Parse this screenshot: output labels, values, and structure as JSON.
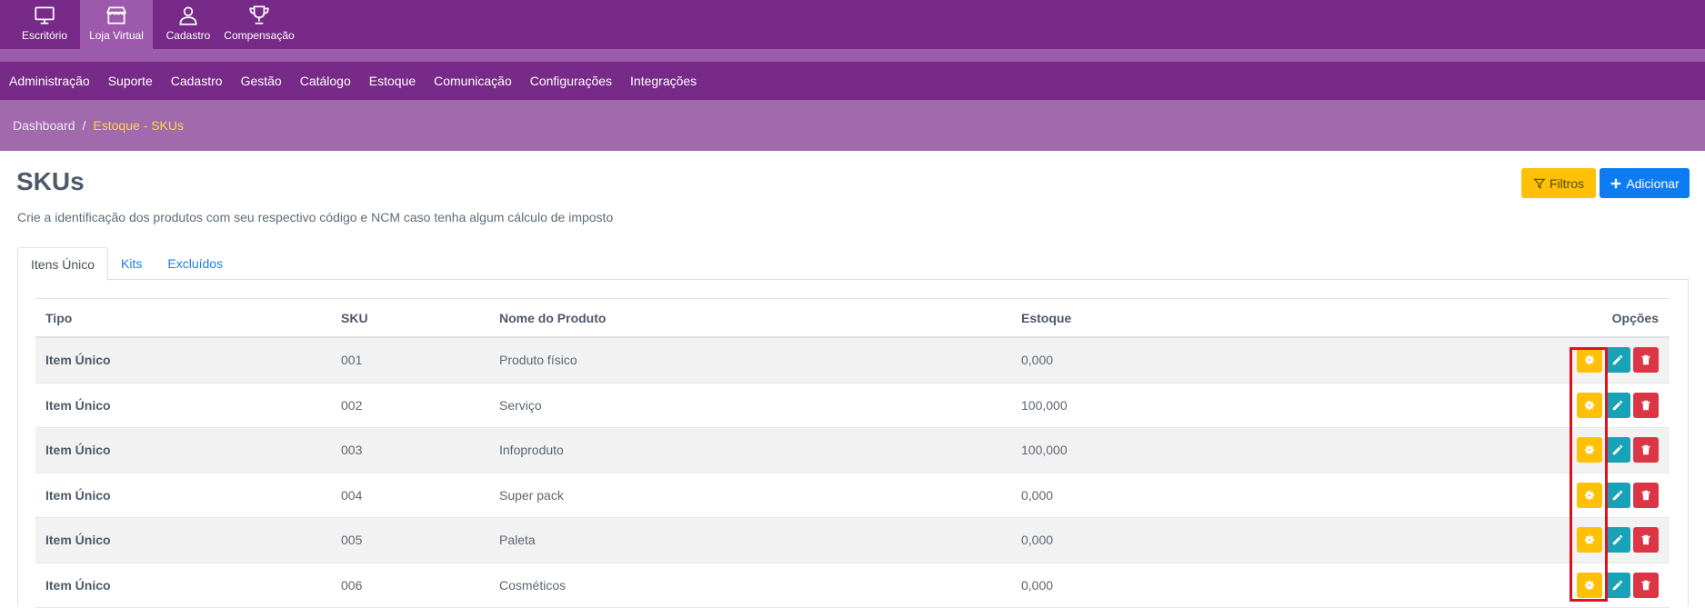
{
  "topbar": {
    "apps": [
      {
        "label": "Escritório",
        "icon": "monitor-icon"
      },
      {
        "label": "Loja Virtual",
        "icon": "store-icon",
        "active": true
      },
      {
        "label": "Cadastro",
        "icon": "user-icon"
      },
      {
        "label": "Compensação",
        "icon": "trophy-icon"
      }
    ]
  },
  "mainnav": {
    "items": [
      "Administração",
      "Suporte",
      "Cadastro",
      "Gestão",
      "Catálogo",
      "Estoque",
      "Comunicação",
      "Configurações",
      "Integrações"
    ]
  },
  "breadcrumb": {
    "home": "Dashboard",
    "separator": "/",
    "current": "Estoque - SKUs"
  },
  "page": {
    "title": "SKUs",
    "description": "Crie a identificação dos produtos com seu respectivo código e NCM caso tenha algum cálculo de imposto",
    "filter_label": "Filtros",
    "add_label": "Adicionar"
  },
  "tabs": [
    "Itens Único",
    "Kits",
    "Excluídos"
  ],
  "table": {
    "headers": {
      "tipo": "Tipo",
      "sku": "SKU",
      "nome": "Nome do Produto",
      "estoque": "Estoque",
      "opcoes": "Opções"
    },
    "rows": [
      {
        "tipo": "Item Único",
        "sku": "001",
        "nome": "Produto físico",
        "estoque": "0,000"
      },
      {
        "tipo": "Item Único",
        "sku": "002",
        "nome": "Serviço",
        "estoque": "100,000"
      },
      {
        "tipo": "Item Único",
        "sku": "003",
        "nome": "Infoproduto",
        "estoque": "100,000"
      },
      {
        "tipo": "Item Único",
        "sku": "004",
        "nome": "Super pack",
        "estoque": "0,000"
      },
      {
        "tipo": "Item Único",
        "sku": "005",
        "nome": "Paleta",
        "estoque": "0,000"
      },
      {
        "tipo": "Item Único",
        "sku": "006",
        "nome": "Cosméticos",
        "estoque": "0,000"
      }
    ]
  },
  "colors": {
    "topbar": "#772a87",
    "breadcrumb_bg": "#a16aad",
    "breadcrumb_current": "#ffd54a",
    "warning": "#ffc107",
    "primary": "#0d7cf2",
    "info": "#17a2b8",
    "danger": "#dc3545",
    "highlight": "#e0101e"
  }
}
